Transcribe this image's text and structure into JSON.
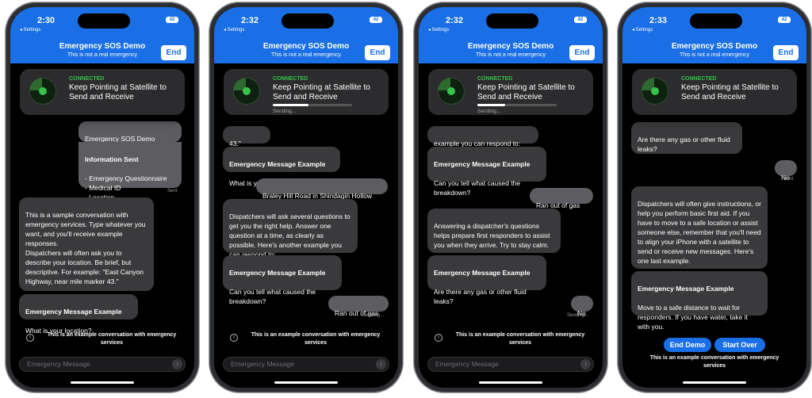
{
  "status_bar": {
    "back_label": "◂ Settings",
    "battery": "42"
  },
  "header": {
    "title": "Emergency SOS Demo",
    "subtitle": "This is not a real emergency",
    "end_label": "End"
  },
  "banner": {
    "status": "CONNECTED",
    "message": "Keep Pointing at Satellite to Send and Receive",
    "sending_label": "Sending..."
  },
  "notice": "This is an example conversation with emergency services",
  "input_placeholder": "Emergency Message",
  "phones": [
    {
      "time": "2:30",
      "messages": [
        {
          "text": "Emergency SOS Demo\n- Lost or Trapped"
        },
        {
          "bold": "Information Sent",
          "text": "- Emergency Questionnaire\n- Medical ID\n- Location"
        },
        {
          "status": "Sent"
        },
        {
          "text": "This is a sample conversation with emergency services. Type whatever you want, and you'll receive example responses.\nDispatchers will often ask you to describe your location. Be brief, but descriptive. For example: \"East Canyon Highway, near mile marker 43.\""
        },
        {
          "bold": "Emergency Message Example",
          "text": "What is your location?"
        }
      ]
    },
    {
      "time": "2:32",
      "messages": [
        {
          "text": "43.\""
        },
        {
          "bold": "Emergency Message Example",
          "text": "What is your location?"
        },
        {
          "text": "Braley Hill Road in Shindagin Hollow"
        },
        {
          "text": "Dispatchers will ask several questions to get you the right help. Answer one question at a time, as clearly as possible. Here's another example you can respond to:"
        },
        {
          "bold": "Emergency Message Example",
          "text": "Can you tell what caused the breakdown?"
        },
        {
          "text": "Ran out of gas"
        },
        {
          "status": "Sending..."
        }
      ]
    },
    {
      "time": "2:32",
      "messages": [
        {
          "text": "example you can respond to:"
        },
        {
          "bold": "Emergency Message Example",
          "text": "Can you tell what caused the breakdown?"
        },
        {
          "text": "Ran out of gas"
        },
        {
          "text": "Answering a dispatcher's questions helps prepare first responders to assist you when they arrive. Try to stay calm."
        },
        {
          "bold": "Emergency Message Example",
          "text": "Are there any gas or other fluid leaks?"
        },
        {
          "text": "No"
        },
        {
          "status": "Sending..."
        }
      ]
    },
    {
      "time": "2:33",
      "messages": [
        {
          "text": "Are there any gas or other fluid leaks?"
        },
        {
          "text": "No"
        },
        {
          "status": "Sent"
        },
        {
          "text": "Dispatchers will often give instructions, or help you perform basic first aid. If you have to move to a safe location or assist someone else, remember that you'll need to align your iPhone with a satellite to send or receive new messages. Here's one last example."
        },
        {
          "bold": "Emergency Message Example",
          "text": "Move to a safe distance to wait for responders. If you have water, take it with you."
        }
      ],
      "buttons": {
        "end_demo": "End Demo",
        "start_over": "Start Over"
      }
    }
  ]
}
